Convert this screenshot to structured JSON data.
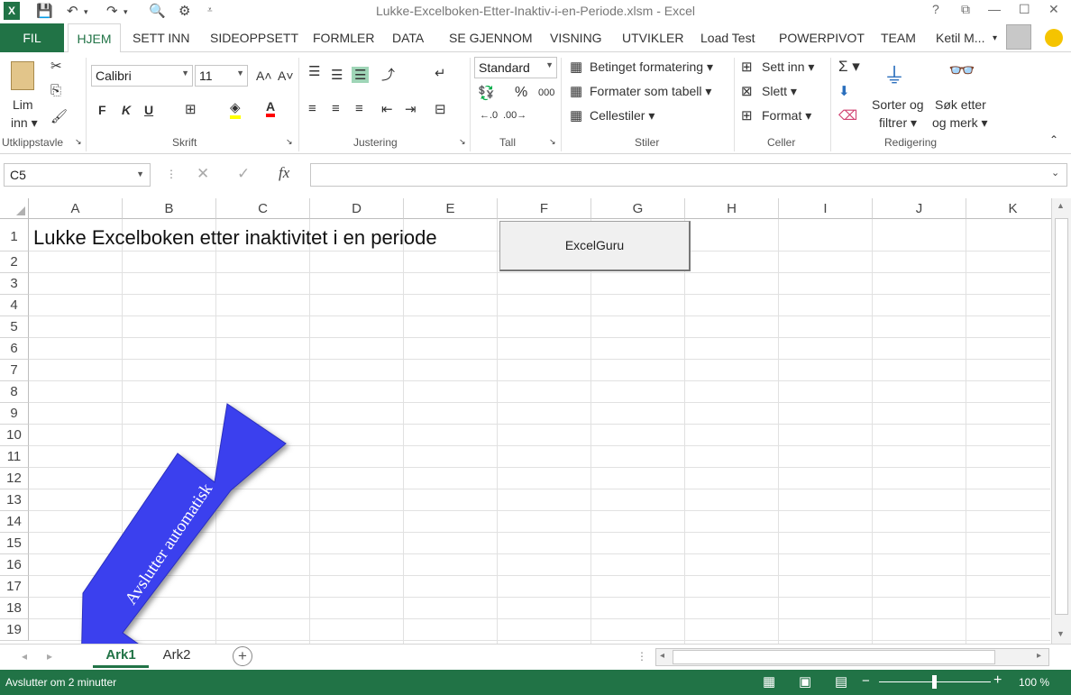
{
  "window": {
    "title": "Lukke-Excelboken-Etter-Inaktiv-i-en-Periode.xlsm - Excel",
    "help": "?",
    "restore": "⧉",
    "minimize": "—",
    "maximize": "☐",
    "close": "✕"
  },
  "tabs": {
    "file": "FIL",
    "items": [
      "HJEM",
      "SETT INN",
      "SIDEOPPSETT",
      "FORMLER",
      "DATA",
      "SE GJENNOM",
      "VISNING",
      "UTVIKLER",
      "Load Test",
      "POWERPIVOT",
      "TEAM"
    ],
    "user": "Ketil M...",
    "user_menu": "▾"
  },
  "ribbon": {
    "clipboard": {
      "paste_line1": "Lim",
      "paste_line2": "inn ▾",
      "label": "Utklippstavle"
    },
    "font": {
      "name": "Calibri",
      "size": "11",
      "bold": "F",
      "italic": "K",
      "underline": "U",
      "grow": "A˄",
      "shrink": "A˅",
      "label": "Skrift"
    },
    "alignment": {
      "label": "Justering"
    },
    "number": {
      "format": "Standard",
      "percent": "%",
      "thousands": "000",
      "label": "Tall"
    },
    "styles": {
      "conditional": "Betinget formatering ▾",
      "as_table": "Formater som tabell ▾",
      "cell_styles": "Cellestiler ▾",
      "label": "Stiler"
    },
    "cells": {
      "insert": "Sett inn ▾",
      "delete": "Slett ▾",
      "format": "Format ▾",
      "label": "Celler"
    },
    "editing": {
      "sum": "Σ ▾",
      "sort_line1": "Sorter og",
      "sort_line2": "filtrer ▾",
      "find_line1": "Søk etter",
      "find_line2": "og merk ▾",
      "label": "Redigering"
    }
  },
  "formula_bar": {
    "name_box": "C5",
    "fx": "fx",
    "value": ""
  },
  "sheet": {
    "columns": [
      "A",
      "B",
      "C",
      "D",
      "E",
      "F",
      "G",
      "H",
      "I",
      "J",
      "K"
    ],
    "rows": [
      "1",
      "2",
      "3",
      "4",
      "5",
      "6",
      "7",
      "8",
      "9",
      "10",
      "11",
      "12",
      "13",
      "14",
      "15",
      "16",
      "17",
      "18",
      "19"
    ],
    "cell_a1": "Lukke Excelboken etter inaktivitet i en periode",
    "button_label": "ExcelGuru",
    "arrow_text": "Avslutter automatisk"
  },
  "sheet_tabs": [
    "Ark1",
    "Ark2"
  ],
  "status": {
    "message": "Avslutter om 2 minutter",
    "zoom": "100 %"
  },
  "colors": {
    "excel_green": "#217346",
    "arrow_blue": "#3b40ee"
  }
}
